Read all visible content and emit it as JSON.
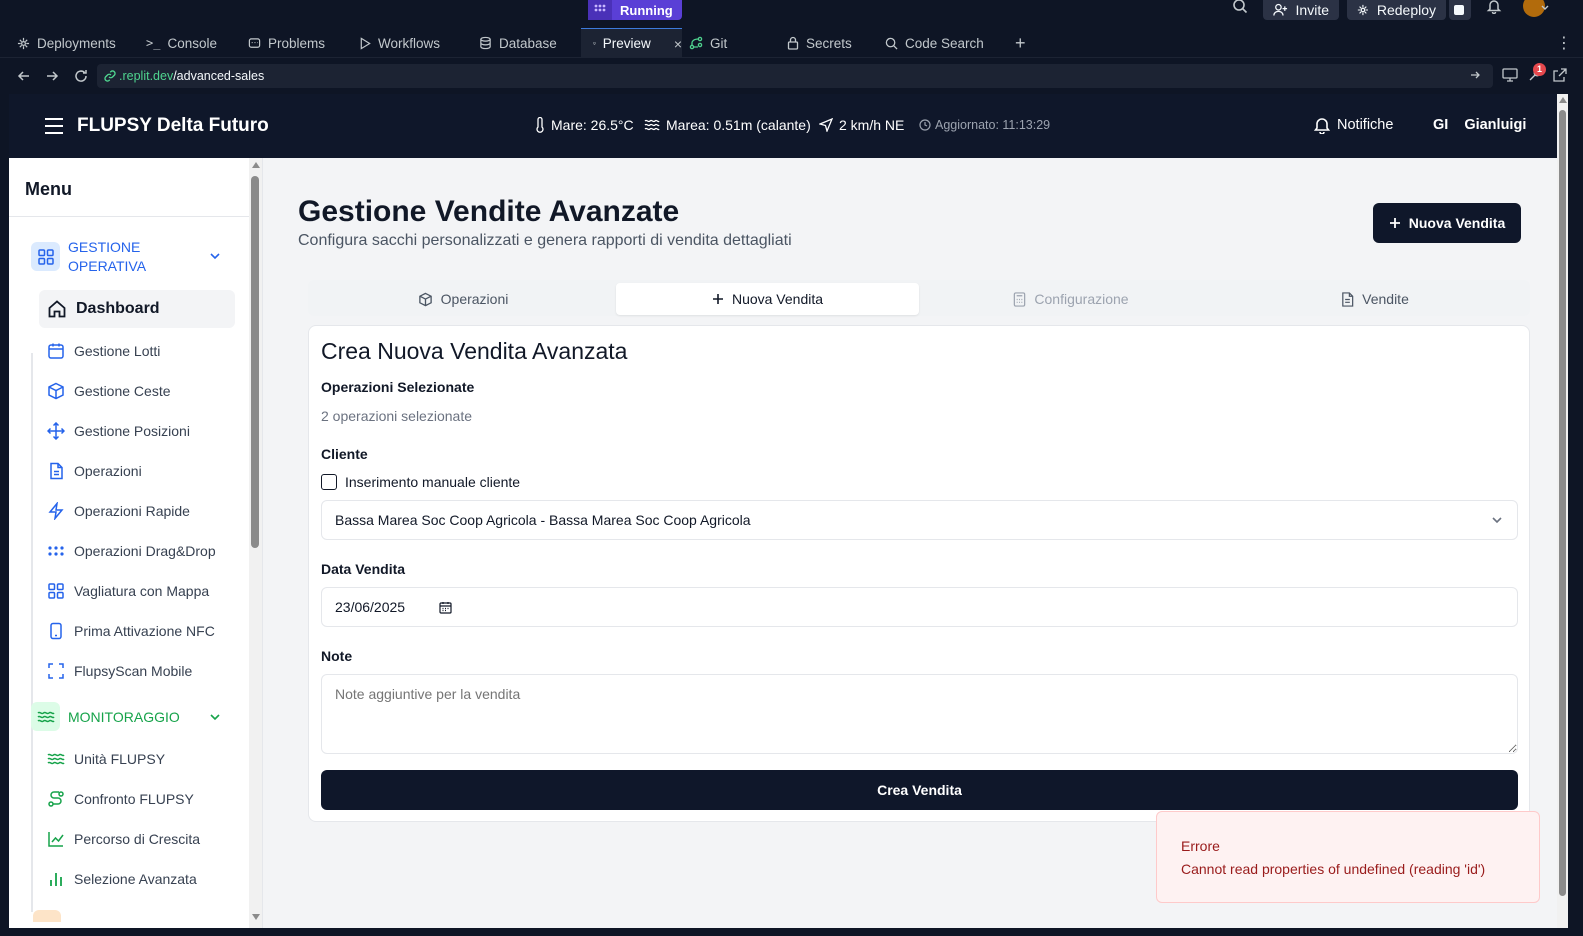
{
  "ide": {
    "run_status": "Running",
    "invite_label": "Invite",
    "redeploy_label": "Redeploy",
    "tabs": [
      {
        "label": "Deployments",
        "icon": "deployments-icon"
      },
      {
        "label": "Console",
        "icon": "console-icon"
      },
      {
        "label": "Problems",
        "icon": "problems-icon"
      },
      {
        "label": "Workflows",
        "icon": "workflows-icon"
      },
      {
        "label": "Database",
        "icon": "database-icon"
      },
      {
        "label": "Preview",
        "icon": "preview-icon",
        "active": true
      },
      {
        "label": "Git",
        "icon": "git-icon"
      },
      {
        "label": "Secrets",
        "icon": "lock-icon"
      },
      {
        "label": "Code Search",
        "icon": "search-icon"
      }
    ],
    "new_tab": "+",
    "url_domain": ".replit.dev",
    "url_path": "/advanced-sales",
    "devtools_badge": "1"
  },
  "header": {
    "app_title": "FLUPSY Delta Futuro",
    "sea_temp": "Mare: 26.5°C",
    "tide": "Marea: 0.51m (calante)",
    "wind": "2 km/h NE",
    "updated": "Aggiornato: 11:13:29",
    "notifications": "Notifiche",
    "user_initials": "GI",
    "user_name": "Gianluigi"
  },
  "sidebar": {
    "title": "Menu",
    "section_operativa": "GESTIONE OPERATIVA",
    "section_monitoraggio": "MONITORAGGIO",
    "operativa_items": [
      {
        "label": "Dashboard",
        "icon": "home-icon"
      },
      {
        "label": "Gestione Lotti",
        "icon": "calendar-icon"
      },
      {
        "label": "Gestione Ceste",
        "icon": "box-icon"
      },
      {
        "label": "Gestione Posizioni",
        "icon": "move-icon"
      },
      {
        "label": "Operazioni",
        "icon": "document-icon"
      },
      {
        "label": "Operazioni Rapide",
        "icon": "lightning-icon"
      },
      {
        "label": "Operazioni Drag&Drop",
        "icon": "grip-icon"
      },
      {
        "label": "Vagliatura con Mappa",
        "icon": "grid-icon"
      },
      {
        "label": "Prima Attivazione NFC",
        "icon": "smartphone-icon"
      },
      {
        "label": "FlupsyScan Mobile",
        "icon": "scan-icon"
      }
    ],
    "monitoraggio_items": [
      {
        "label": "Unità FLUPSY",
        "icon": "waves-icon"
      },
      {
        "label": "Confronto FLUPSY",
        "icon": "route-icon"
      },
      {
        "label": "Percorso di Crescita",
        "icon": "line-chart-icon"
      },
      {
        "label": "Selezione Avanzata",
        "icon": "bar-chart-icon"
      }
    ]
  },
  "page": {
    "title": "Gestione Vendite Avanzate",
    "subtitle": "Configura sacchi personalizzati e genera rapporti di vendita dettagliati",
    "new_sale_button": "Nuova Vendita",
    "tabs": [
      {
        "label": "Operazioni",
        "state": "normal"
      },
      {
        "label": "Nuova Vendita",
        "state": "active"
      },
      {
        "label": "Configurazione",
        "state": "disabled"
      },
      {
        "label": "Vendite",
        "state": "normal"
      }
    ]
  },
  "form": {
    "title": "Crea Nuova Vendita Avanzata",
    "selected_ops_label": "Operazioni Selezionate",
    "selected_ops_value": "2 operazioni selezionate",
    "client_label": "Cliente",
    "manual_client_label": "Inserimento manuale cliente",
    "manual_client_checked": false,
    "client_value": "Bassa Marea Soc Coop Agricola - Bassa Marea Soc Coop Agricola",
    "date_label": "Data Vendita",
    "date_value": "23/06/2025",
    "notes_label": "Note",
    "notes_placeholder": "Note aggiuntive per la vendita",
    "submit_label": "Crea Vendita"
  },
  "toast": {
    "title": "Errore",
    "message": "Cannot read properties of undefined (reading 'id')"
  },
  "colors": {
    "header_bg": "#0f172a",
    "operativa_accent": "#2563eb",
    "monitoraggio_accent": "#16a34a",
    "error": "#991b1b",
    "replit_run": "#5a3fd6"
  }
}
